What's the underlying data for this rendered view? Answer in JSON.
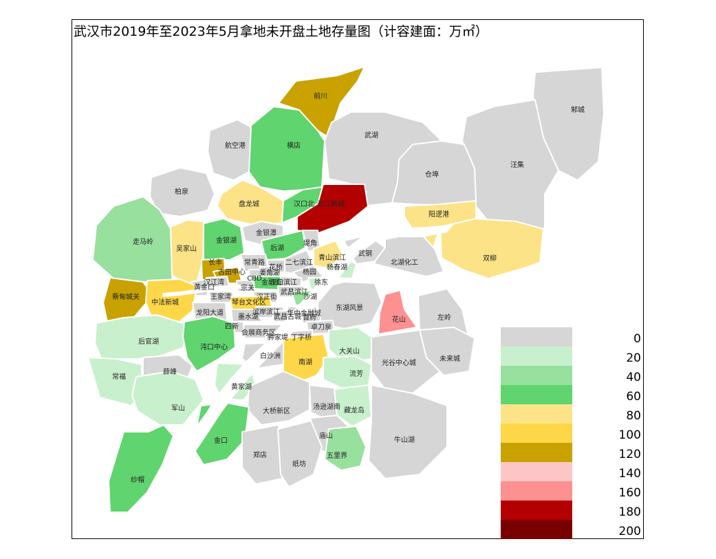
{
  "title": "武汉市2019年至2023年5月拿地未开盘土地存量图（计容建面：万㎡）",
  "legend": {
    "ticks": [
      "0",
      "20",
      "40",
      "60",
      "80",
      "100",
      "120",
      "140",
      "160",
      "180",
      "200"
    ],
    "colors": [
      "#d6d6d6",
      "#c9f0cd",
      "#97e09e",
      "#60d46e",
      "#fde387",
      "#fed748",
      "#c9a200",
      "#fdc6c6",
      "#fd9090",
      "#b30000",
      "#7a0000"
    ]
  },
  "districts": [
    {
      "label": "前川",
      "bin": 6
    },
    {
      "label": "横店",
      "bin": 3
    },
    {
      "label": "航空港",
      "bin": 0
    },
    {
      "label": "武湖",
      "bin": 0
    },
    {
      "label": "邾城",
      "bin": 0
    },
    {
      "label": "汪集",
      "bin": 0
    },
    {
      "label": "仓埠",
      "bin": 0
    },
    {
      "label": "柏泉",
      "bin": 0
    },
    {
      "label": "盘龙城",
      "bin": 4
    },
    {
      "label": "汉口北",
      "bin": 3
    },
    {
      "label": "长江新城",
      "bin": 9
    },
    {
      "label": "阳逻港",
      "bin": 4
    },
    {
      "label": "双柳",
      "bin": 4
    },
    {
      "label": "走马岭",
      "bin": 2
    },
    {
      "label": "吴家山",
      "bin": 4
    },
    {
      "label": "金银湖",
      "bin": 3
    },
    {
      "label": "金银潭",
      "bin": 0
    },
    {
      "label": "后湖",
      "bin": 3
    },
    {
      "label": "堤角",
      "bin": 0
    },
    {
      "label": "长丰",
      "bin": 6
    },
    {
      "label": "常青路",
      "bin": 0
    },
    {
      "label": "花桥",
      "bin": 0
    },
    {
      "label": "二七滨江",
      "bin": 0
    },
    {
      "label": "青山滨江",
      "bin": 4
    },
    {
      "label": "杨春湖",
      "bin": 1
    },
    {
      "label": "武钢",
      "bin": 0
    },
    {
      "label": "北湖化工",
      "bin": 0
    },
    {
      "label": "古田中心",
      "bin": 6
    },
    {
      "label": "CBD",
      "bin": 0
    },
    {
      "label": "姜角湖",
      "bin": 0
    },
    {
      "label": "杨园",
      "bin": 0
    },
    {
      "label": "汉江湾",
      "bin": 0
    },
    {
      "label": "黄金口",
      "bin": 0
    },
    {
      "label": "宗关",
      "bin": 0
    },
    {
      "label": "金融街",
      "bin": 3
    },
    {
      "label": "汉口滨江",
      "bin": 0
    },
    {
      "label": "徐东",
      "bin": 1
    },
    {
      "label": "蔡甸城关",
      "bin": 6
    },
    {
      "label": "中法新城",
      "bin": 5
    },
    {
      "label": "王家湾",
      "bin": 0
    },
    {
      "label": "汉正街",
      "bin": 0
    },
    {
      "label": "武昌滨江",
      "bin": 0
    },
    {
      "label": "沙湖",
      "bin": 2
    },
    {
      "label": "琴台文化区",
      "bin": 5
    },
    {
      "label": "东湖风景",
      "bin": 0
    },
    {
      "label": "花山",
      "bin": 8
    },
    {
      "label": "左岭",
      "bin": 0
    },
    {
      "label": "龙阳大道",
      "bin": 0
    },
    {
      "label": "墨水湖",
      "bin": 0
    },
    {
      "label": "滨岸滨江",
      "bin": 0
    },
    {
      "label": "武昌古城",
      "bin": 0
    },
    {
      "label": "华中金融城",
      "bin": 0
    },
    {
      "label": "首府",
      "bin": 0
    },
    {
      "label": "四新",
      "bin": 0
    },
    {
      "label": "会展商务区",
      "bin": 0
    },
    {
      "label": "卓刀泉",
      "bin": 0
    },
    {
      "label": "后官湖",
      "bin": 1
    },
    {
      "label": "沌口中心",
      "bin": 3
    },
    {
      "label": "钟家堤",
      "bin": 0
    },
    {
      "label": "丁字桥",
      "bin": 0
    },
    {
      "label": "大关山",
      "bin": 1
    },
    {
      "label": "光谷中心城",
      "bin": 0
    },
    {
      "label": "未来城",
      "bin": 0
    },
    {
      "label": "常福",
      "bin": 1
    },
    {
      "label": "薛峰",
      "bin": 0
    },
    {
      "label": "白沙洲",
      "bin": 0
    },
    {
      "label": "南湖",
      "bin": 5
    },
    {
      "label": "流芳",
      "bin": 1
    },
    {
      "label": "黄家湖",
      "bin": 1
    },
    {
      "label": "军山",
      "bin": 1
    },
    {
      "label": "大桥新区",
      "bin": 0
    },
    {
      "label": "汤逊湖南",
      "bin": 0
    },
    {
      "label": "藏龙岛",
      "bin": 1
    },
    {
      "label": "牛山湖",
      "bin": 0
    },
    {
      "label": "金口",
      "bin": 3
    },
    {
      "label": "庙山",
      "bin": 0
    },
    {
      "label": "郑店",
      "bin": 0
    },
    {
      "label": "纸坊",
      "bin": 0
    },
    {
      "label": "五里界",
      "bin": 2
    },
    {
      "label": "纱帽",
      "bin": 3
    }
  ]
}
